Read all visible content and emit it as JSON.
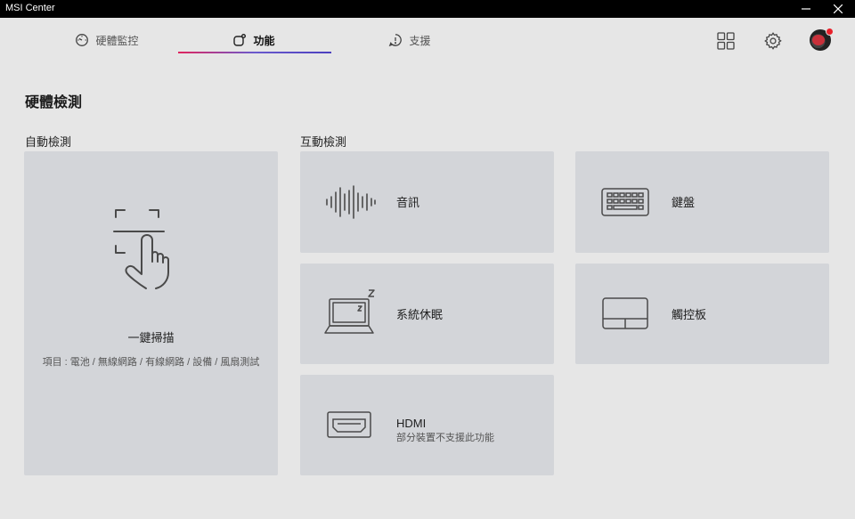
{
  "window": {
    "title": "MSI Center"
  },
  "tabs": [
    {
      "label": "硬體監控",
      "icon": "gauge-icon",
      "active": false
    },
    {
      "label": "功能",
      "icon": "feature-icon",
      "active": true
    },
    {
      "label": "支援",
      "icon": "support-icon",
      "active": false
    }
  ],
  "accent": {
    "underline_start": "#e0245e",
    "underline_end": "#4b3fbf"
  },
  "page": {
    "title": "硬體檢測"
  },
  "auto_section": {
    "label": "自動檢測",
    "card": {
      "title": "一鍵掃描",
      "items": "項目 : 電池 / 無線網路 / 有線網路 / 設備 / 風扇測試",
      "icon": "touch-scan-icon"
    }
  },
  "interactive_section": {
    "label": "互動檢測",
    "cards": [
      {
        "label": "音訊",
        "icon": "audio-wave-icon"
      },
      {
        "label": "鍵盤",
        "icon": "keyboard-icon"
      },
      {
        "label": "系統休眠",
        "icon": "laptop-sleep-icon"
      },
      {
        "label": "觸控板",
        "icon": "touchpad-icon"
      },
      {
        "label": "HDMI",
        "sub": "部分裝置不支援此功能",
        "icon": "hdmi-icon"
      }
    ]
  }
}
